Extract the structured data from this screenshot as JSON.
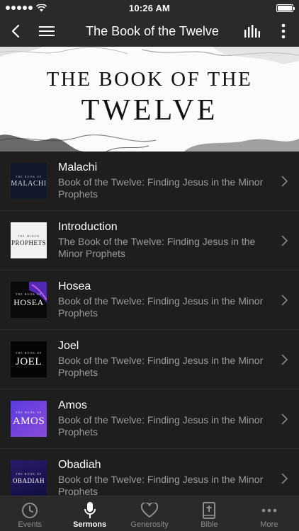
{
  "status": {
    "time": "10:26 AM"
  },
  "nav": {
    "title": "The Book of the Twelve"
  },
  "banner": {
    "line1": "THE BOOK OF THE",
    "line2": "TWELVE"
  },
  "items": [
    {
      "title": "Malachi",
      "subtitle": "Book of the Twelve: Finding Jesus in the Minor Prophets",
      "thumb": "MALACHI",
      "thumb_small": "THE BOOK OF",
      "bg": "#10182a",
      "fg": "#d8dde6"
    },
    {
      "title": "Introduction",
      "subtitle": "The Book of the Twelve: Finding Jesus in the Minor Prophets",
      "thumb": "PROPHETS",
      "thumb_small": "THE MINOR",
      "bg": "#f2f2f0",
      "fg": "#111111"
    },
    {
      "title": "Hosea",
      "subtitle": "Book of the Twelve: Finding Jesus in the Minor Prophets",
      "thumb": "HOSEA",
      "thumb_small": "THE BOOK OF",
      "bg": "#0a0a0a",
      "fg": "#ffffff"
    },
    {
      "title": "Joel",
      "subtitle": "Book of the Twelve: Finding Jesus in the Minor Prophets",
      "thumb": "JOEL",
      "thumb_small": "THE BOOK OF",
      "bg": "#050505",
      "fg": "#ffffff"
    },
    {
      "title": "Amos",
      "subtitle": "Book of the Twelve: Finding Jesus in the Minor Prophets",
      "thumb": "AMOS",
      "thumb_small": "THE BOOK OF",
      "bg": "#6b3bd6",
      "fg": "#ffffff"
    },
    {
      "title": "Obadiah",
      "subtitle": "Book of the Twelve: Finding Jesus in the Minor Prophets",
      "thumb": "OBADIAH",
      "thumb_small": "THE BOOK OF",
      "bg": "#1a1a4a",
      "fg": "#ffffff"
    }
  ],
  "tabs": [
    {
      "label": "Events",
      "icon": "clock-icon"
    },
    {
      "label": "Sermons",
      "icon": "microphone-icon",
      "active": true
    },
    {
      "label": "Generosity",
      "icon": "heart-icon"
    },
    {
      "label": "Bible",
      "icon": "bible-icon"
    },
    {
      "label": "More",
      "icon": "more-dots-icon"
    }
  ],
  "colors": {
    "background": "#1e1e1e",
    "bar": "#2a2a2a",
    "subtitle": "#9b9b9b",
    "inactive_tab": "#8e8e8e"
  }
}
